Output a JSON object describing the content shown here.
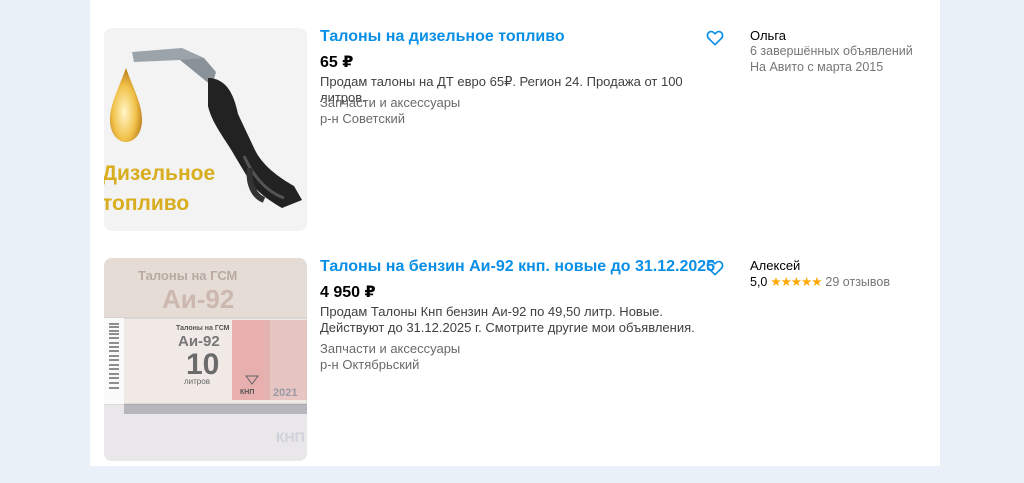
{
  "listings": [
    {
      "title": "Талоны на дизельное топливо",
      "price": "65 ₽",
      "description": "Продам талоны на ДТ евро 65₽. Регион 24. Продажа от 100 литров.",
      "category": "Запчасти и аксессуары",
      "district": "р-н Советский",
      "image_caption_line1": "Дизельное",
      "image_caption_line2": "топливо",
      "seller": {
        "name": "Ольга",
        "completed": "6 завершённых объявлений",
        "since": "На Авито с марта 2015"
      }
    },
    {
      "title": "Талоны на бензин Аи-92 кнп. новые до 31.12.2025",
      "price": "4 950 ₽",
      "description": "Продам Талоны Кнп бензин Аи-92 по 49,50 литр. Новые. Действуют до 31.12.2025 г. Смотрите другие мои объявления.",
      "category": "Запчасти и аксессуары",
      "district": "р-н Октябрьский",
      "image_text": {
        "header": "Талоны на ГСМ",
        "fuel": "Аи-92",
        "amount": "10",
        "unit": "литров",
        "brand": "КНП",
        "year": "2021"
      },
      "seller": {
        "name": "Алексей",
        "rating": "5,0",
        "stars": "★★★★★",
        "reviews": "29 отзывов"
      }
    }
  ],
  "icons": {
    "favorite": "heart-outline-icon"
  },
  "colors": {
    "title_link": "#0a8fe6",
    "star": "#ffa800",
    "page_bg": "#eaf0f7"
  }
}
